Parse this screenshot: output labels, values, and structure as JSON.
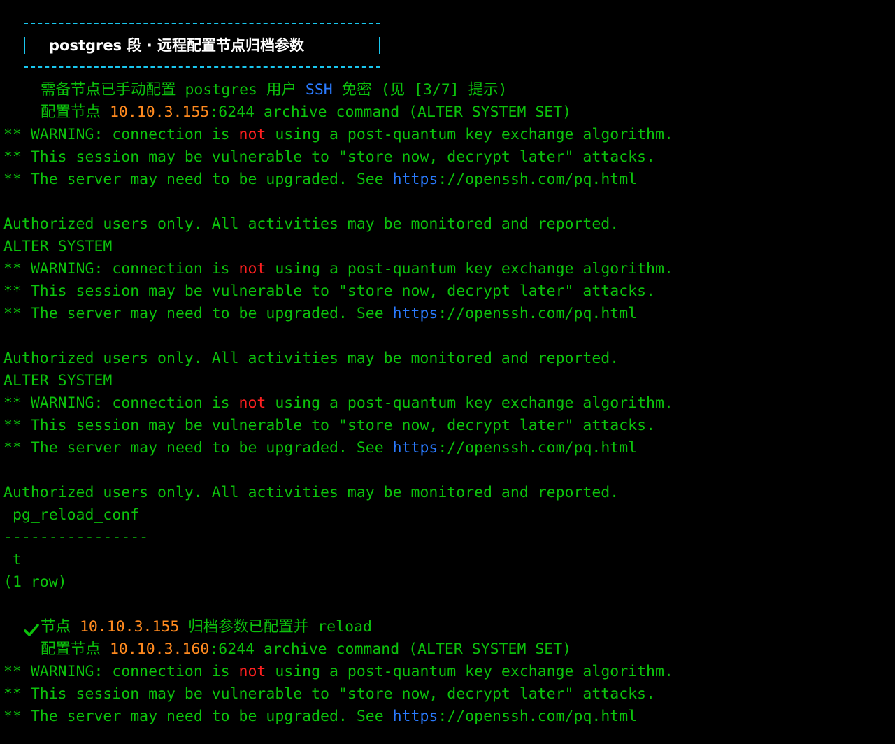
{
  "banner": {
    "title": "postgres 段 · 远程配置节点归档参数"
  },
  "hint": {
    "prefix": "需备节点已手动配置 postgres 用户 ",
    "ssh": "SSH",
    "suffix": " 免密 (见 [3/7] 提示)"
  },
  "node1": {
    "prefix": "配置节点 ",
    "ip": "10.10.3.155",
    "suffix": ":6244 archive_command (ALTER SYSTEM SET)"
  },
  "node2": {
    "prefix": "配置节点 ",
    "ip": "10.10.3.160",
    "suffix": ":6244 archive_command (ALTER SYSTEM SET)"
  },
  "warning": {
    "w1_prefix": "** WARNING: connection is ",
    "w1_not": "not",
    "w1_suffix": " using a post-quantum key exchange algorithm.",
    "w2": "** This session may be vulnerable to \"store now, decrypt later\" attacks.",
    "w3_prefix": "** The server may need to be upgraded. See ",
    "w3_https": "https",
    "w3_suffix": "://openssh.com/pq.html"
  },
  "authorized": "Authorized users only. All activities may be monitored and reported.",
  "alter_system": "ALTER SYSTEM",
  "query_result": {
    "column": " pg_reload_conf",
    "separator": "----------------",
    "value": " t",
    "rowcount": "(1 row)"
  },
  "success": {
    "icon": "check-icon",
    "prefix": "节点 ",
    "ip": "10.10.3.155",
    "suffix": " 归档参数已配置并 reload"
  },
  "colors": {
    "background": "#000000",
    "text_green": "#0cc20c",
    "banner_cyan": "#19c6ee",
    "red": "#ff2020",
    "blue": "#2a7bff",
    "orange": "#ff8a1f"
  }
}
